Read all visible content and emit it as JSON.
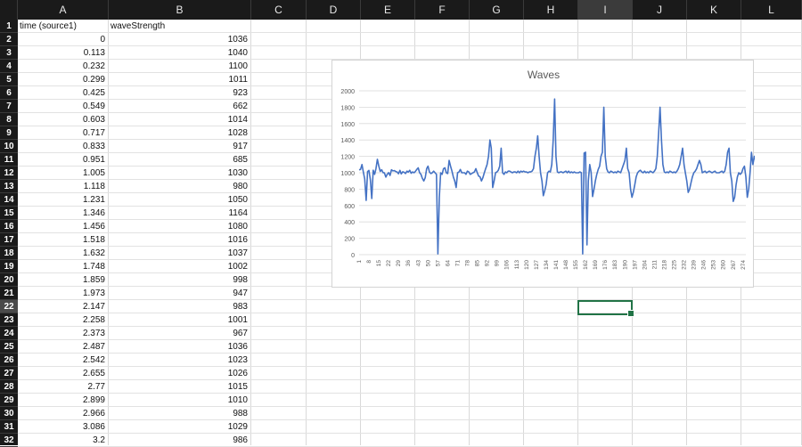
{
  "sheet": {
    "columns": [
      "A",
      "B",
      "C",
      "D",
      "E",
      "F",
      "G",
      "H",
      "I",
      "J",
      "K",
      "L"
    ],
    "selected_column": "I",
    "selected_row": 22,
    "headers": {
      "A": "time (source1)",
      "B": "waveStrength"
    },
    "rows": [
      {
        "row": 2,
        "time": "0",
        "wave": "1036"
      },
      {
        "row": 3,
        "time": "0.113",
        "wave": "1040"
      },
      {
        "row": 4,
        "time": "0.232",
        "wave": "1100"
      },
      {
        "row": 5,
        "time": "0.299",
        "wave": "1011"
      },
      {
        "row": 6,
        "time": "0.425",
        "wave": "923"
      },
      {
        "row": 7,
        "time": "0.549",
        "wave": "662"
      },
      {
        "row": 8,
        "time": "0.603",
        "wave": "1014"
      },
      {
        "row": 9,
        "time": "0.717",
        "wave": "1028"
      },
      {
        "row": 10,
        "time": "0.833",
        "wave": "917"
      },
      {
        "row": 11,
        "time": "0.951",
        "wave": "685"
      },
      {
        "row": 12,
        "time": "1.005",
        "wave": "1030"
      },
      {
        "row": 13,
        "time": "1.118",
        "wave": "980"
      },
      {
        "row": 14,
        "time": "1.231",
        "wave": "1050"
      },
      {
        "row": 15,
        "time": "1.346",
        "wave": "1164"
      },
      {
        "row": 16,
        "time": "1.456",
        "wave": "1080"
      },
      {
        "row": 17,
        "time": "1.518",
        "wave": "1016"
      },
      {
        "row": 18,
        "time": "1.632",
        "wave": "1037"
      },
      {
        "row": 19,
        "time": "1.748",
        "wave": "1002"
      },
      {
        "row": 20,
        "time": "1.859",
        "wave": "998"
      },
      {
        "row": 21,
        "time": "1.973",
        "wave": "947"
      },
      {
        "row": 22,
        "time": "2.147",
        "wave": "983"
      },
      {
        "row": 23,
        "time": "2.258",
        "wave": "1001"
      },
      {
        "row": 24,
        "time": "2.373",
        "wave": "967"
      },
      {
        "row": 25,
        "time": "2.487",
        "wave": "1036"
      },
      {
        "row": 26,
        "time": "2.542",
        "wave": "1023"
      },
      {
        "row": 27,
        "time": "2.655",
        "wave": "1026"
      },
      {
        "row": 28,
        "time": "2.77",
        "wave": "1015"
      },
      {
        "row": 29,
        "time": "2.899",
        "wave": "1010"
      },
      {
        "row": 30,
        "time": "2.966",
        "wave": "988"
      },
      {
        "row": 31,
        "time": "3.086",
        "wave": "1029"
      },
      {
        "row": 32,
        "time": "3.2",
        "wave": "986"
      }
    ]
  },
  "chart_data": {
    "type": "line",
    "title": "Waves",
    "xlabel": "",
    "ylabel": "",
    "ylim": [
      0,
      2000
    ],
    "yticks": [
      0,
      200,
      400,
      600,
      800,
      1000,
      1200,
      1400,
      1600,
      1800,
      2000
    ],
    "x_tick_labels": [
      "1",
      "8",
      "15",
      "22",
      "29",
      "36",
      "43",
      "50",
      "57",
      "64",
      "71",
      "78",
      "85",
      "92",
      "99",
      "106",
      "113",
      "120",
      "127",
      "134",
      "141",
      "148",
      "155",
      "162",
      "169",
      "176",
      "183",
      "190",
      "197",
      "204",
      "211",
      "218",
      "225",
      "232",
      "239",
      "246",
      "253",
      "260",
      "267",
      "274"
    ],
    "n_points": 276,
    "grid": true,
    "legend": "none",
    "color": "#4472c4",
    "series": [
      {
        "values": [
          1036,
          1040,
          1100,
          1011,
          923,
          662,
          1014,
          1028,
          917,
          685,
          1030,
          980,
          1050,
          1164,
          1080,
          1016,
          1037,
          1002,
          998,
          947,
          983,
          1001,
          967,
          1036,
          1023,
          1026,
          1015,
          1010,
          988,
          1029,
          986,
          1012,
          1005,
          990,
          1020,
          1008,
          1030,
          995,
          1010,
          1000,
          1015,
          1040,
          1060,
          1000,
          980,
          930,
          900,
          940,
          1050,
          1080,
          1010,
          990,
          1000,
          1020,
          1000,
          980,
          10,
          700,
          1000,
          980,
          1050,
          1060,
          1000,
          990,
          1150,
          1080,
          1020,
          950,
          900,
          820,
          1000,
          1010,
          1040,
          1000,
          1000,
          1000,
          980,
          1020,
          1010,
          980,
          990,
          1000,
          1010,
          1050,
          1000,
          960,
          950,
          900,
          940,
          1000,
          1050,
          1100,
          1200,
          1400,
          1300,
          820,
          900,
          1000,
          1010,
          1030,
          1080,
          1300,
          1000,
          980,
          1010,
          1000,
          1020,
          1020,
          1010,
          1000,
          1010,
          1010,
          1000,
          1020,
          1000,
          1020,
          1010,
          1020,
          1010,
          1010,
          1000,
          1010,
          1010,
          1020,
          1050,
          1200,
          1300,
          1450,
          1200,
          1000,
          900,
          720,
          780,
          860,
          1000,
          1020,
          1010,
          1100,
          1400,
          1900,
          1200,
          1010,
          1000,
          1010,
          1010,
          1000,
          1010,
          1020,
          1000,
          1020,
          1000,
          1010,
          1000,
          1010,
          1000,
          1000,
          1000,
          1010,
          1000,
          10,
          1240,
          1250,
          120,
          900,
          1100,
          1000,
          710,
          800,
          900,
          980,
          1040,
          1080,
          1200,
          1250,
          1800,
          1200,
          1050,
          1010,
          1000,
          1020,
          1010,
          1000,
          1010,
          1000,
          1020,
          1010,
          1000,
          1050,
          1100,
          1150,
          1300,
          1050,
          1000,
          800,
          700,
          760,
          850,
          950,
          1000,
          1020,
          1030,
          1010,
          1000,
          1020,
          1000,
          1010,
          1000,
          1020,
          1010,
          1000,
          1020,
          1050,
          1200,
          1500,
          1800,
          1400,
          1100,
          1010,
          1000,
          1010,
          1000,
          1020,
          1010,
          1000,
          1010,
          1000,
          1020,
          1050,
          1100,
          1200,
          1300,
          1100,
          1000,
          900,
          760,
          800,
          880,
          950,
          1000,
          1020,
          1050,
          1100,
          1150,
          1100,
          1000,
          1010,
          1020,
          1000,
          1010,
          1020,
          1010,
          1000,
          1010,
          1020,
          1000,
          1000,
          1000,
          1010,
          1020,
          1000,
          1020,
          1100,
          1250,
          1300,
          1000,
          900,
          650,
          700,
          850,
          950,
          1000,
          980,
          1000,
          1050,
          1080,
          950,
          700,
          800,
          1000,
          1250,
          1100,
          1200,
          1150,
          1000,
          1020,
          1000
        ]
      }
    ]
  }
}
